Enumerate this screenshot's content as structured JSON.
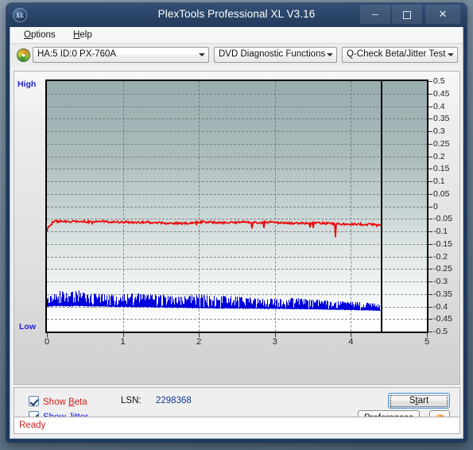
{
  "window": {
    "title": "PlexTools Professional XL V3.16",
    "logo_text": "XL",
    "minimize": "–",
    "maximize": "",
    "close": "✕"
  },
  "menu": {
    "items": [
      {
        "label": "Options",
        "accel": "O"
      },
      {
        "label": "Help",
        "accel": "H"
      }
    ]
  },
  "toolbar": {
    "drive_icon": "disc-icon",
    "drive_select": "HA:5 ID:0  PX-760A",
    "function_select": "DVD Diagnostic Functions",
    "test_select": "Q-Check Beta/Jitter Test"
  },
  "controls": {
    "show_beta_label": "Show Beta",
    "show_jitter_label": "Show Jitter",
    "show_beta_checked": true,
    "show_jitter_checked": true,
    "lsn_label": "LSN:",
    "lsn_value": "2298368",
    "start_label": "Start",
    "preferences_label": "Preferences",
    "info_label": "i"
  },
  "status": {
    "text": "Ready"
  },
  "colors": {
    "beta": "#ee0000",
    "jitter": "#0000dd",
    "axis_label": "#2020d0",
    "status": "#d12020",
    "titlebar": "#2a4467"
  },
  "chart_data": {
    "type": "line",
    "title": "",
    "xlabel": "",
    "ylabel": "",
    "high_label": "High",
    "low_label": "Low",
    "xlim": [
      0,
      5
    ],
    "ylim": [
      -0.5,
      0.5
    ],
    "xticks": [
      0,
      1,
      2,
      3,
      4,
      5
    ],
    "xtick_labels": [
      "0",
      "1",
      "2",
      "3",
      "4",
      "5"
    ],
    "yticks": [
      0.5,
      0.45,
      0.4,
      0.35,
      0.3,
      0.25,
      0.2,
      0.15,
      0.1,
      0.05,
      0,
      -0.05,
      -0.1,
      -0.15,
      -0.2,
      -0.25,
      -0.3,
      -0.35,
      -0.4,
      -0.45,
      -0.5
    ],
    "ytick_labels": [
      "0.5",
      "0.45",
      "0.4",
      "0.35",
      "0.3",
      "0.25",
      "0.2",
      "0.15",
      "0.1",
      "0.05",
      "0",
      "-0.05",
      "-0.1",
      "-0.15",
      "-0.2",
      "-0.25",
      "-0.3",
      "-0.35",
      "-0.4",
      "-0.45",
      "-0.5"
    ],
    "grid": true,
    "grid_style": "dashed",
    "data_end_x": 4.39,
    "legend_position": "below-chart",
    "series": [
      {
        "name": "Beta",
        "color": "#ee0000",
        "kind": "line",
        "noise": 0.009,
        "x": [
          0.0,
          0.04,
          0.08,
          0.15,
          0.25,
          0.4,
          0.55,
          0.7,
          0.85,
          1.0,
          1.15,
          1.3,
          1.45,
          1.6,
          1.75,
          1.9,
          2.05,
          2.2,
          2.35,
          2.5,
          2.65,
          2.8,
          2.95,
          3.1,
          3.25,
          3.4,
          3.55,
          3.7,
          3.85,
          4.0,
          4.15,
          4.3,
          4.39
        ],
        "y": [
          -0.088,
          -0.082,
          -0.062,
          -0.06,
          -0.061,
          -0.059,
          -0.062,
          -0.06,
          -0.063,
          -0.062,
          -0.064,
          -0.063,
          -0.066,
          -0.067,
          -0.068,
          -0.066,
          -0.062,
          -0.064,
          -0.066,
          -0.065,
          -0.063,
          -0.066,
          -0.063,
          -0.066,
          -0.068,
          -0.067,
          -0.066,
          -0.069,
          -0.071,
          -0.07,
          -0.072,
          -0.073,
          -0.072
        ]
      },
      {
        "name": "Jitter",
        "color": "#0000dd",
        "kind": "band",
        "x": [
          0.0,
          0.05,
          0.1,
          0.18,
          0.28,
          0.4,
          0.52,
          0.65,
          0.8,
          0.95,
          1.1,
          1.25,
          1.4,
          1.55,
          1.7,
          1.85,
          2.0,
          2.15,
          2.3,
          2.45,
          2.6,
          2.75,
          2.9,
          3.05,
          3.2,
          3.35,
          3.5,
          3.65,
          3.8,
          3.95,
          4.1,
          4.25,
          4.39
        ],
        "y_top": [
          -0.368,
          -0.352,
          -0.335,
          -0.338,
          -0.347,
          -0.332,
          -0.352,
          -0.347,
          -0.352,
          -0.354,
          -0.348,
          -0.346,
          -0.352,
          -0.355,
          -0.362,
          -0.356,
          -0.352,
          -0.358,
          -0.357,
          -0.36,
          -0.362,
          -0.365,
          -0.368,
          -0.37,
          -0.366,
          -0.368,
          -0.372,
          -0.375,
          -0.378,
          -0.38,
          -0.382,
          -0.386,
          -0.388
        ],
        "y_bottom": [
          -0.4,
          -0.398,
          -0.396,
          -0.397,
          -0.398,
          -0.396,
          -0.398,
          -0.398,
          -0.399,
          -0.4,
          -0.4,
          -0.401,
          -0.402,
          -0.403,
          -0.404,
          -0.404,
          -0.405,
          -0.406,
          -0.406,
          -0.406,
          -0.407,
          -0.407,
          -0.408,
          -0.408,
          -0.409,
          -0.41,
          -0.41,
          -0.411,
          -0.412,
          -0.413,
          -0.414,
          -0.415,
          -0.416
        ]
      }
    ]
  }
}
